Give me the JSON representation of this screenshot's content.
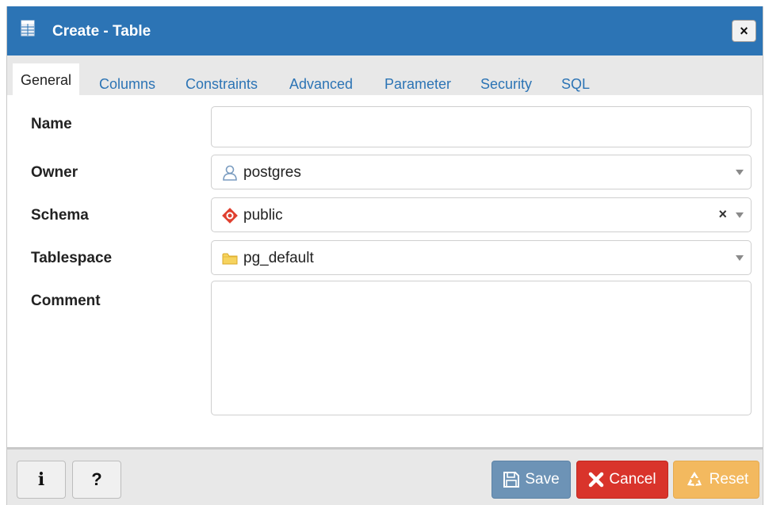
{
  "window": {
    "title": "Create - Table",
    "close_label": "×"
  },
  "tabs": [
    {
      "label": "General",
      "active": true
    },
    {
      "label": "Columns",
      "active": false
    },
    {
      "label": "Constraints",
      "active": false
    },
    {
      "label": "Advanced",
      "active": false
    },
    {
      "label": "Parameter",
      "active": false
    },
    {
      "label": "Security",
      "active": false
    },
    {
      "label": "SQL",
      "active": false
    }
  ],
  "form": {
    "name": {
      "label": "Name",
      "value": ""
    },
    "owner": {
      "label": "Owner",
      "value": "postgres",
      "icon": "user-icon"
    },
    "schema": {
      "label": "Schema",
      "value": "public",
      "icon": "schema-icon",
      "clear": "×"
    },
    "tablespace": {
      "label": "Tablespace",
      "value": "pg_default",
      "icon": "folder-icon"
    },
    "comment": {
      "label": "Comment",
      "value": ""
    }
  },
  "footer": {
    "info_label": "i",
    "help_label": "?",
    "save_label": "Save",
    "cancel_label": "Cancel",
    "reset_label": "Reset"
  },
  "colors": {
    "titlebar": "#2c74b5",
    "tab_link": "#2c74b5",
    "save": "#6d93b6",
    "cancel": "#d9342b",
    "reset": "#f3b95f"
  }
}
